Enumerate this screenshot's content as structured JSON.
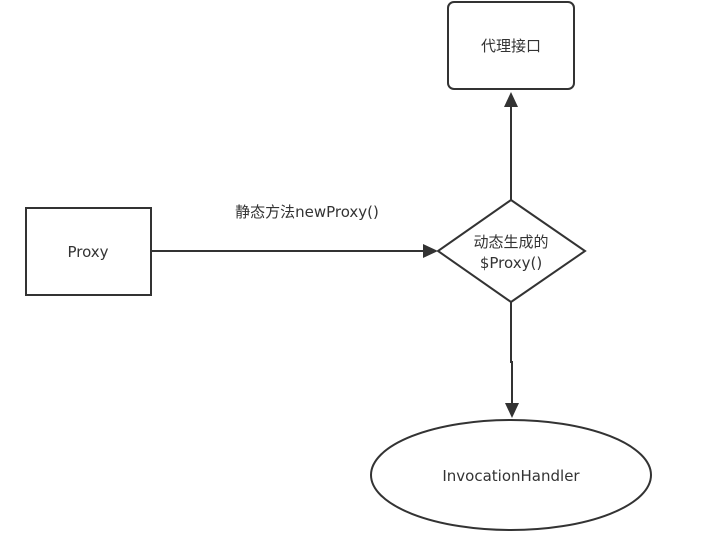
{
  "nodes": {
    "proxy_box": {
      "label": "Proxy"
    },
    "proxy_interface_box": {
      "label": "代理接口"
    },
    "dynamic_proxy_decision": {
      "label_line1": "动态生成的",
      "label_line2": "$Proxy()"
    },
    "invocation_handler_ellipse": {
      "label": "InvocationHandler"
    }
  },
  "edges": {
    "proxy_to_decision": {
      "label": "静态方法newProxy()"
    },
    "decision_to_interface": {
      "label": ""
    },
    "decision_to_handler": {
      "label": ""
    }
  },
  "colors": {
    "stroke": "#333333",
    "fill": "#ffffff",
    "text": "#333333"
  }
}
